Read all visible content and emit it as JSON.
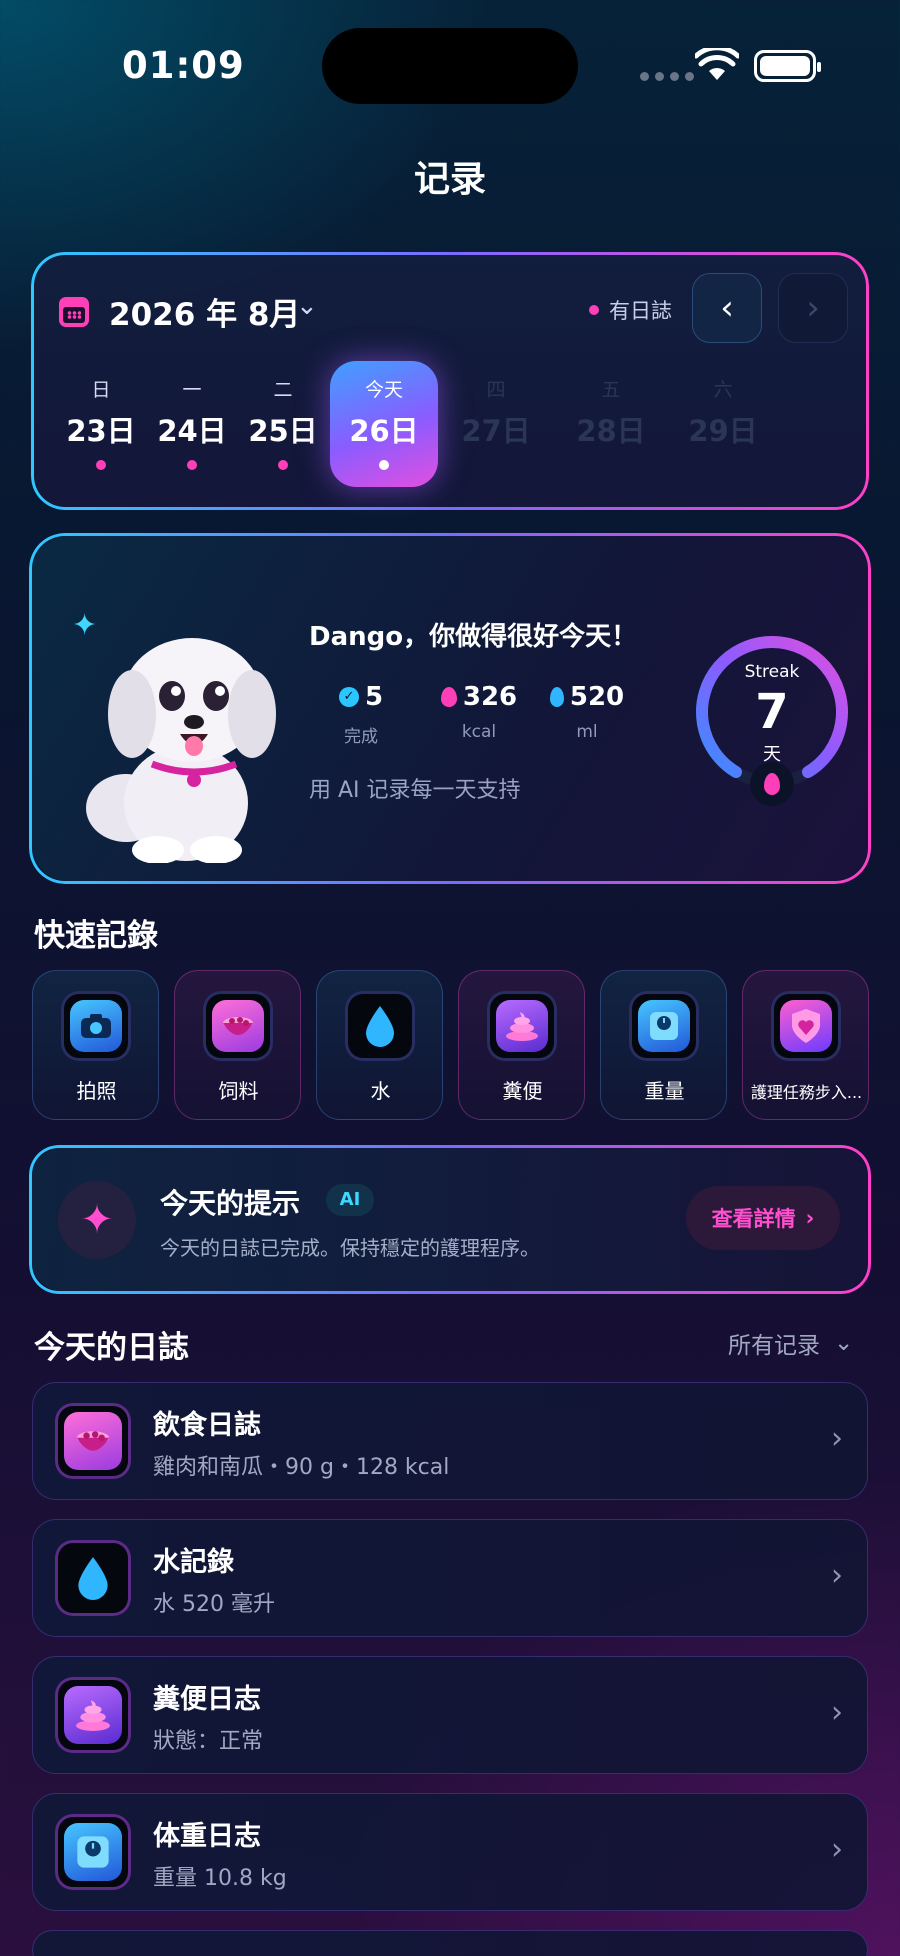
{
  "status": {
    "time": "01:09"
  },
  "page": {
    "title": "记录"
  },
  "calendar": {
    "month_label": "2026 年 8月",
    "has_log_label": "有日誌",
    "days": [
      {
        "weekday": "日",
        "date": "23日",
        "has_log": true
      },
      {
        "weekday": "一",
        "date": "24日",
        "has_log": true
      },
      {
        "weekday": "二",
        "date": "25日",
        "has_log": true
      },
      {
        "weekday": "今天",
        "date": "26日",
        "has_log": true,
        "selected": true
      },
      {
        "weekday": "四",
        "date": "27日",
        "future": true
      },
      {
        "weekday": "五",
        "date": "28日",
        "future": true
      },
      {
        "weekday": "六",
        "date": "29日",
        "future": true
      }
    ]
  },
  "hero": {
    "title": "Dango，你做得很好今天！",
    "stats": [
      {
        "value": "5",
        "label": "完成",
        "icon": "check-circle-icon"
      },
      {
        "value": "326",
        "label": "kcal",
        "icon": "flame-icon"
      },
      {
        "value": "520",
        "label": "ml",
        "icon": "water-drop-icon"
      }
    ],
    "subtitle": "用 AI 记录每一天支持",
    "streak": {
      "label": "Streak",
      "value": "7",
      "unit": "天"
    }
  },
  "quick": {
    "title": "快速記錄",
    "items": [
      {
        "label": "拍照",
        "icon": "camera-icon"
      },
      {
        "label": "饲料",
        "icon": "food-bowl-icon"
      },
      {
        "label": "水",
        "icon": "water-drop-icon"
      },
      {
        "label": "糞便",
        "icon": "poop-icon"
      },
      {
        "label": "重量",
        "icon": "scale-icon"
      },
      {
        "label": "護理任務步入...",
        "icon": "heart-shield-icon"
      }
    ]
  },
  "tip": {
    "title": "今天的提示",
    "badge": "AI",
    "text": "今天的日誌已完成。保持穩定的護理程序。",
    "button": "查看詳情"
  },
  "logs": {
    "title": "今天的日誌",
    "filter": "所有记录",
    "items": [
      {
        "title": "飲食日誌",
        "subtitle": "雞肉和南瓜・90 g・128 kcal",
        "icon": "food-bowl-icon"
      },
      {
        "title": "水記錄",
        "subtitle": "水 520 毫升",
        "icon": "water-drop-icon"
      },
      {
        "title": "糞便日志",
        "subtitle": "狀態：正常",
        "icon": "poop-icon"
      },
      {
        "title": "体重日志",
        "subtitle": "重量 10.8 kg",
        "icon": "scale-icon"
      }
    ]
  },
  "colors": {
    "accent_pink": "#ff3fb8",
    "accent_cyan": "#2ec8ff",
    "accent_purple": "#7a6bff"
  }
}
